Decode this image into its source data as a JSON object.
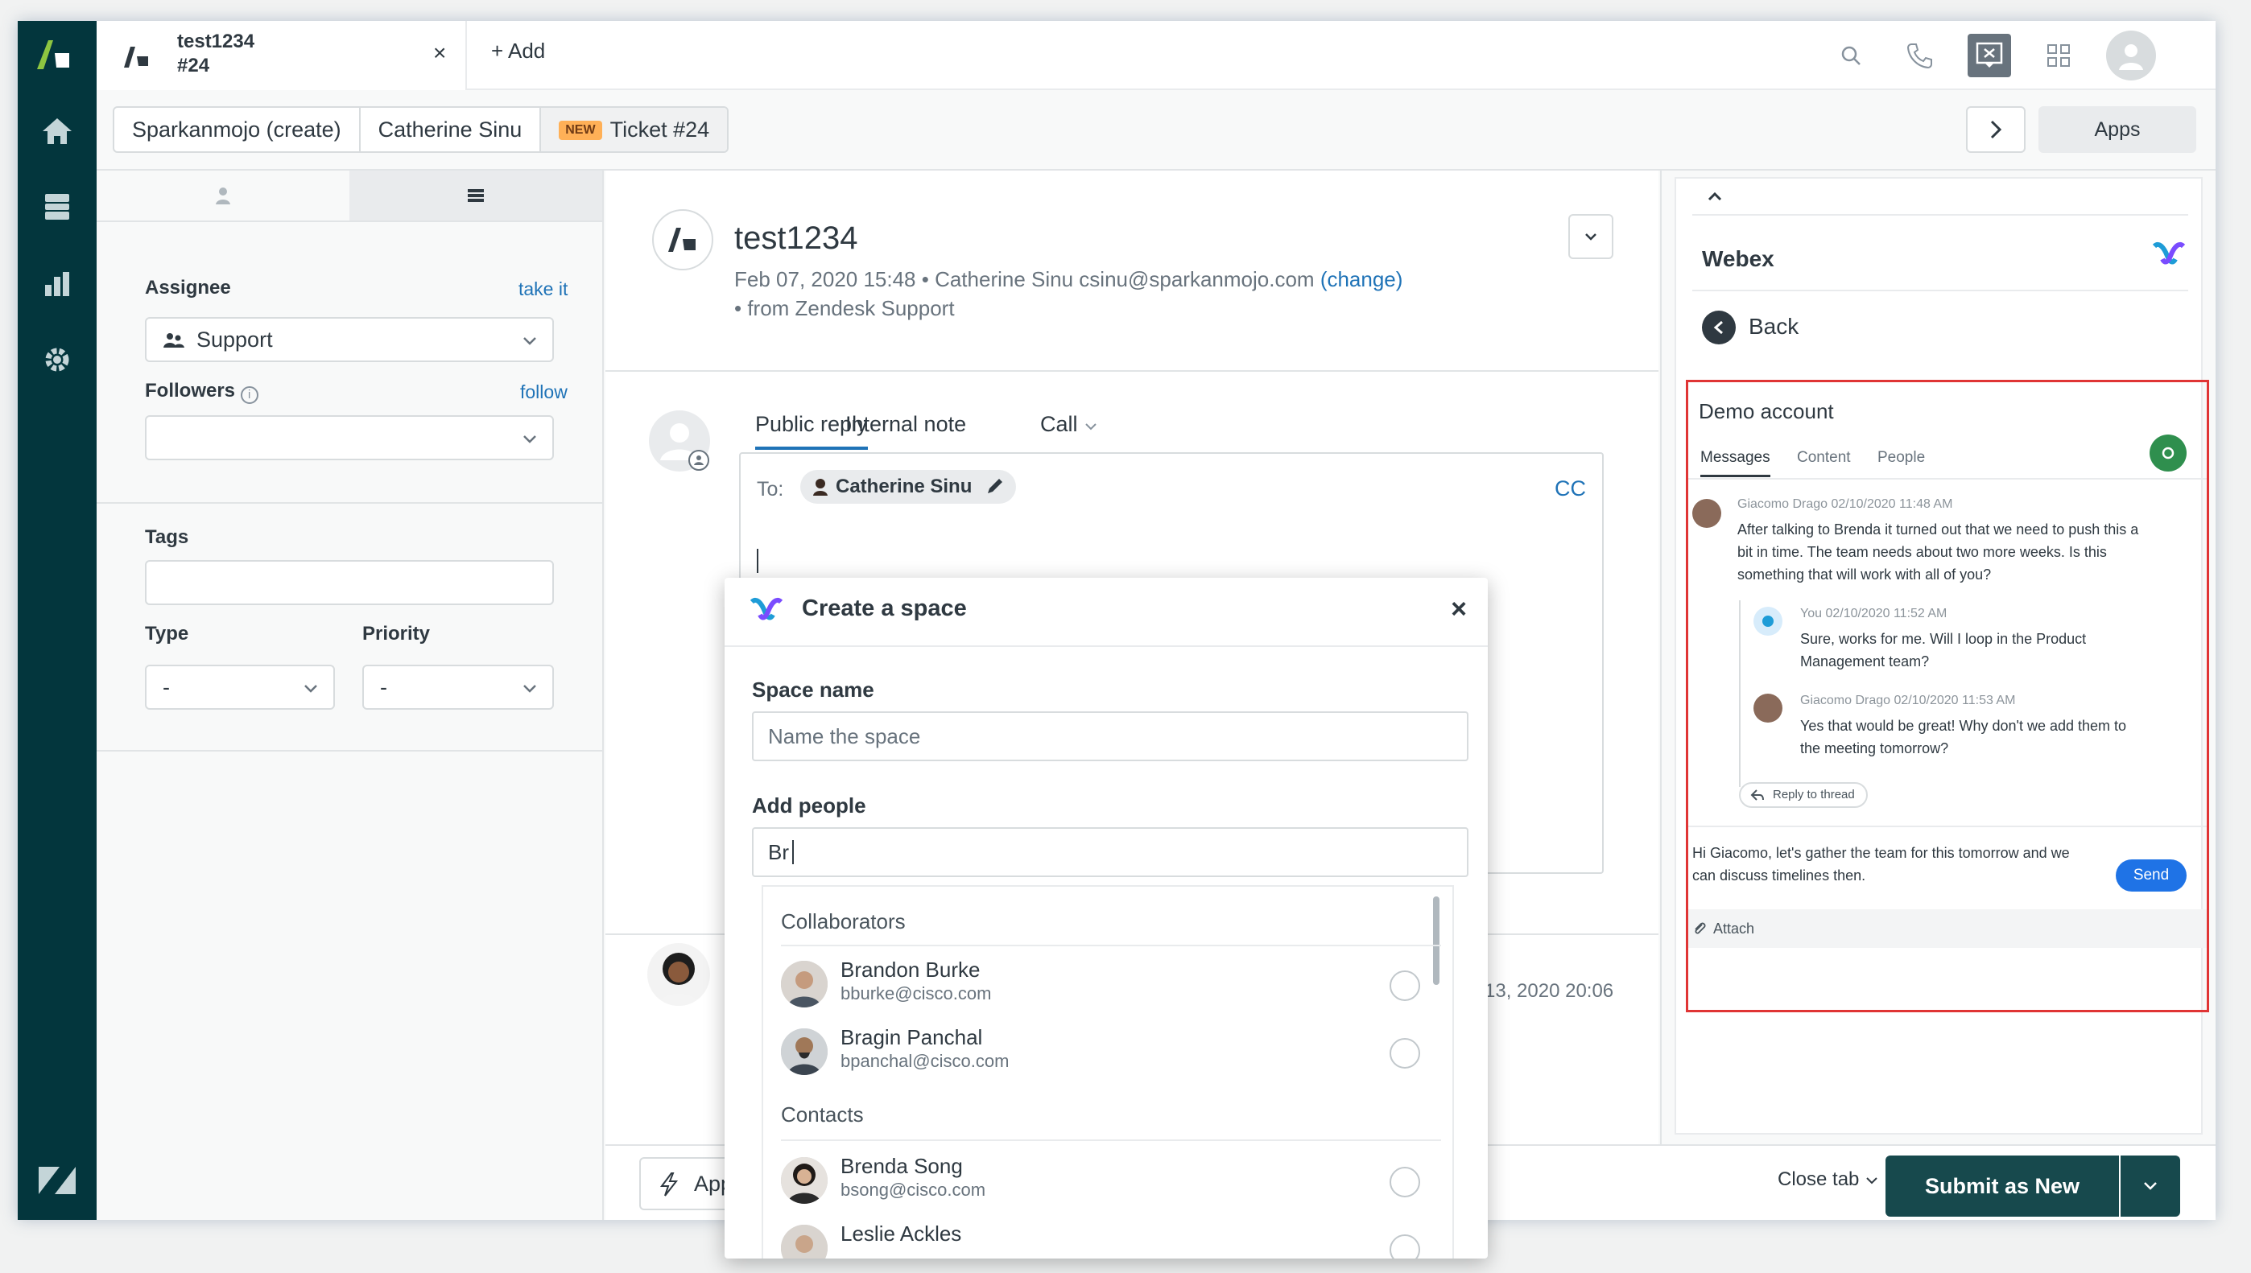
{
  "tab": {
    "title": "test1234",
    "subtitle": "#24",
    "close": "×",
    "add_label": "+ Add"
  },
  "breadcrumb": {
    "item1": "Sparkanmojo (create)",
    "item2": "Catherine Sinu",
    "badge": "NEW",
    "item3": "Ticket #24",
    "apps": "Apps"
  },
  "properties": {
    "assignee_label": "Assignee",
    "take_it": "take it",
    "assignee_value": "Support",
    "followers_label": "Followers",
    "follow": "follow",
    "tags_label": "Tags",
    "type_label": "Type",
    "priority_label": "Priority",
    "type_value": "-",
    "priority_value": "-"
  },
  "ticket": {
    "title": "test1234",
    "meta": "Feb 07, 2020 15:48 • Catherine Sinu   csinu@sparkanmojo.com",
    "change": "(change)",
    "source": "• from Zendesk Support"
  },
  "reply": {
    "tab_public": "Public reply",
    "tab_internal": "Internal note",
    "tab_call": "Call",
    "to": "To:",
    "to_name": "Catherine Sinu",
    "cc": "CC",
    "timestamp": "13, 2020 20:06"
  },
  "footer": {
    "apply": "Apply",
    "close_tab": "Close tab",
    "submit": "Submit as New"
  },
  "modal": {
    "title": "Create a space",
    "close": "×",
    "space_name_label": "Space name",
    "space_name_placeholder": "Name the space",
    "add_people_label": "Add people",
    "add_people_value": "Br",
    "collaborators_label": "Collaborators",
    "contacts_label": "Contacts",
    "collaborators": [
      {
        "name": "Brandon Burke",
        "email": "bburke@cisco.com"
      },
      {
        "name": "Bragin Panchal",
        "email": "bpanchal@cisco.com"
      }
    ],
    "contacts": [
      {
        "name": "Brenda Song",
        "email": "bsong@cisco.com"
      },
      {
        "name": "Leslie Ackles",
        "email": ""
      }
    ]
  },
  "webex": {
    "title": "Webex",
    "back": "Back",
    "space_name": "Demo account",
    "tabs": [
      "Messages",
      "Content",
      "People"
    ],
    "messages": [
      {
        "meta": "Giacomo Drago   02/10/2020 11:48 AM",
        "text": "After talking to Brenda it turned out that we need to push this a bit in time. The team needs about two more weeks. Is this something that will work with all of you?"
      },
      {
        "meta": "You   02/10/2020 11:52 AM",
        "text": "Sure, works for me. Will I loop in the Product Management team?"
      },
      {
        "meta": "Giacomo Drago   02/10/2020 11:53 AM",
        "text": "Yes that would be great! Why don't we add them to the meeting tomorrow?"
      }
    ],
    "reply_thread": "Reply to thread",
    "compose": "Hi Giacomo, let's gather the team for this tomorrow and we can discuss timelines then.",
    "send": "Send",
    "attach": "Attach"
  },
  "colors": {
    "nav_bg": "#03363d",
    "submit_bg": "#17494d",
    "link": "#1f73b7",
    "send": "#1f73e6",
    "highlight": "#e03535"
  },
  "icons": [
    "zendesk-logo-icon",
    "home-icon",
    "views-icon",
    "reporting-icon",
    "admin-gear-icon",
    "search-icon",
    "phone-icon",
    "chat-icon",
    "product-tray-icon",
    "user-avatar-icon",
    "webex-logo-icon"
  ]
}
